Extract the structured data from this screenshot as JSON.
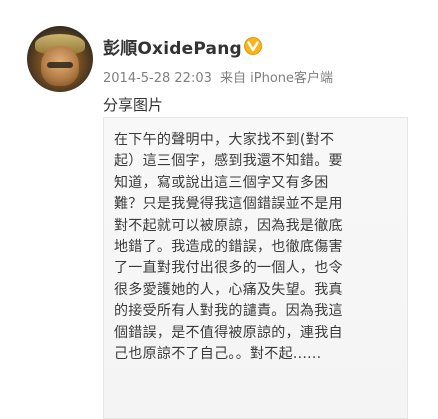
{
  "post": {
    "author": {
      "name": "彭順OxidePang",
      "verified_color": "#f7b41b"
    },
    "timestamp": "2014-5-28 22:03",
    "source": "来自 iPhone客户端",
    "text": "分享图片",
    "image_lines": [
      "在下午的聲明中，大家找不到(對不",
      "起）這三個字，感到我還不知錯。要",
      "知道，寫或說出這三個字又有多困",
      "難？只是我覺得我這個錯誤並不是用",
      "對不起就可以被原諒，因為我是徹底",
      "地錯了。我造成的錯誤，也徹底傷害",
      "了一直對我付出很多的一個人，也令",
      "很多愛護她的人，心痛及失望。我真",
      "的接受所有人對我的譴責。因為我這",
      "個錯誤，是不值得被原諒的，連我自",
      "己也原諒不了自己。。對不起......"
    ]
  }
}
